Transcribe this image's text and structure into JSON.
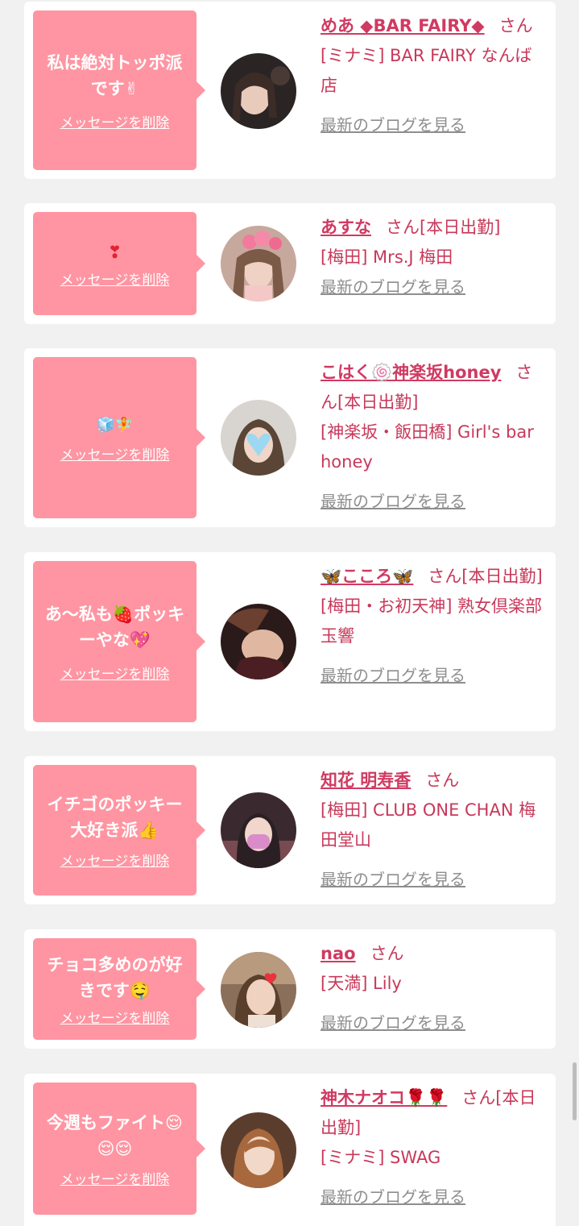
{
  "items": [
    {
      "message": "私は絶対トッポ派です✌",
      "delete_label": "メッセージを削除",
      "name": "めあ ◆BAR FAIRY◆",
      "san": "さん",
      "shop": "[ミナミ] BAR FAIRY なんば店",
      "blog_label": "最新のブログを見る"
    },
    {
      "message": "❣",
      "delete_label": "メッセージを削除",
      "name": "あすな",
      "san": "さん[本日出勤]",
      "shop": "[梅田] Mrs.J 梅田",
      "blog_label": "最新のブログを見る"
    },
    {
      "message": "🧊🧚",
      "delete_label": "メッセージを削除",
      "name": "こはく🍥神楽坂honey",
      "san": "さん[本日出勤]",
      "shop": "[神楽坂・飯田橋] Girl's bar honey",
      "blog_label": "最新のブログを見る"
    },
    {
      "message": "あ〜私も🍓ポッキーやな💖",
      "delete_label": "メッセージを削除",
      "name": "🦋こころ🦋",
      "san": "さん[本日出勤]",
      "shop": "[梅田・お初天神] 熟女倶楽部 玉響",
      "blog_label": "最新のブログを見る"
    },
    {
      "message": "イチゴのポッキー大好き派👍",
      "delete_label": "メッセージを削除",
      "name": "知花 明寿香",
      "san": "さん",
      "shop": "[梅田] CLUB ONE CHAN 梅田堂山",
      "blog_label": "最新のブログを見る"
    },
    {
      "message": "チョコ多めのが好きです🤤",
      "delete_label": "メッセージを削除",
      "name": "nao",
      "san": "さん",
      "shop": "[天満] Lily",
      "blog_label": "最新のブログを見る"
    },
    {
      "message": "今週もファイト😌😌😌",
      "delete_label": "メッセージを削除",
      "name": "神木ナオコ🌹🌹",
      "san": "さん[本日出勤]",
      "shop": "[ミナミ] SWAG",
      "blog_label": "最新のブログを見る"
    }
  ],
  "colors": {
    "bubble": "#ff95a2",
    "name": "#d03a62",
    "text": "#c8385a",
    "blog_link": "#8e8e8e",
    "background": "#f1f1f1"
  }
}
